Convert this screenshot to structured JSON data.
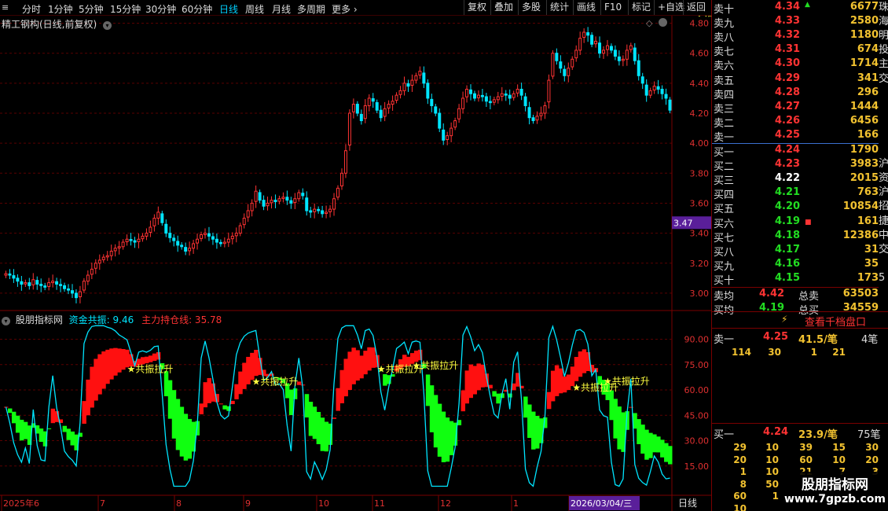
{
  "toolbar": {
    "periods": [
      "分时",
      "1分钟",
      "5分钟",
      "15分钟",
      "30分钟",
      "60分钟",
      "日线",
      "周线",
      "月线",
      "多周期",
      "更多"
    ],
    "active_period": "日线",
    "tools": [
      "复权",
      "叠加",
      "多股",
      "统计",
      "画线",
      "F10",
      "标记",
      "+自选",
      "返回"
    ]
  },
  "main_chart": {
    "title": "精工钢构(日线,前复权)",
    "price_ticks": [
      "4.80",
      "4.60",
      "4.40",
      "4.20",
      "4.00",
      "3.80",
      "3.60",
      "3.40",
      "3.20",
      "3.00"
    ],
    "current_price_tag": "3.47"
  },
  "indicator": {
    "name": "股朋指标网",
    "line1_label": "资金共振: 9.46",
    "line2_label": "主力持仓线: 35.78",
    "ticks": [
      "90.00",
      "75.00",
      "60.00",
      "45.00",
      "30.00",
      "15.00"
    ],
    "signal_label": "★共振拉升"
  },
  "x_axis": {
    "labels": [
      "2025年6",
      "7",
      "8",
      "9",
      "10",
      "11",
      "12",
      "1",
      "2026/03/04/三"
    ],
    "period_label": "日线"
  },
  "chart_data": {
    "type": "candlestick",
    "symbol": "精工钢构",
    "period": "日线",
    "ylim": [
      2.9,
      4.85
    ],
    "closes": [
      3.13,
      3.12,
      3.1,
      3.08,
      3.06,
      3.07,
      3.05,
      3.09,
      3.06,
      3.05,
      3.04,
      3.07,
      3.08,
      3.06,
      3.05,
      3.03,
      3.02,
      3.0,
      2.97,
      3.01,
      3.08,
      3.12,
      3.16,
      3.2,
      3.22,
      3.24,
      3.25,
      3.28,
      3.3,
      3.31,
      3.34,
      3.36,
      3.35,
      3.34,
      3.36,
      3.38,
      3.4,
      3.44,
      3.5,
      3.54,
      3.47,
      3.4,
      3.37,
      3.35,
      3.32,
      3.31,
      3.28,
      3.3,
      3.33,
      3.36,
      3.39,
      3.4,
      3.38,
      3.36,
      3.34,
      3.33,
      3.34,
      3.36,
      3.38,
      3.4,
      3.45,
      3.5,
      3.55,
      3.6,
      3.68,
      3.62,
      3.58,
      3.6,
      3.62,
      3.61,
      3.63,
      3.64,
      3.62,
      3.6,
      3.63,
      3.67,
      3.65,
      3.55,
      3.54,
      3.56,
      3.55,
      3.53,
      3.54,
      3.56,
      3.63,
      3.7,
      3.8,
      3.95,
      4.2,
      4.26,
      4.2,
      4.15,
      4.25,
      4.3,
      4.28,
      4.22,
      4.17,
      4.23,
      4.26,
      4.28,
      4.32,
      4.35,
      4.4,
      4.38,
      4.42,
      4.45,
      4.48,
      4.4,
      4.3,
      4.25,
      4.2,
      4.1,
      4.02,
      4.05,
      4.1,
      4.15,
      4.23,
      4.3,
      4.36,
      4.33,
      4.3,
      4.32,
      4.31,
      4.28,
      4.27,
      4.29,
      4.31,
      4.33,
      4.32,
      4.3,
      4.33,
      4.36,
      4.32,
      4.25,
      4.17,
      4.15,
      4.18,
      4.2,
      4.25,
      4.42,
      4.6,
      4.55,
      4.5,
      4.45,
      4.5,
      4.56,
      4.62,
      4.7,
      4.74,
      4.72,
      4.66,
      4.68,
      4.6,
      4.62,
      4.65,
      4.62,
      4.58,
      4.55,
      4.56,
      4.62,
      4.65,
      4.55,
      4.45,
      4.4,
      4.32,
      4.35,
      4.38,
      4.36,
      4.33,
      4.3,
      4.22
    ],
    "resonance_label": "资金共振",
    "holding_label": "主力持仓线",
    "resonance_value": 9.46,
    "holding_value": 35.78,
    "indicator_ylim": [
      0,
      100
    ],
    "signal_days": [
      31,
      63,
      95,
      104,
      145,
      153,
      175,
      188
    ]
  },
  "orderbook": {
    "asks": [
      {
        "label": "卖十",
        "price": "4.34",
        "vol": "6677",
        "color": "#ff3333"
      },
      {
        "label": "卖九",
        "price": "4.33",
        "vol": "2580",
        "color": "#ff3333"
      },
      {
        "label": "卖八",
        "price": "4.32",
        "vol": "1180",
        "color": "#ff3333"
      },
      {
        "label": "卖七",
        "price": "4.31",
        "vol": "674",
        "color": "#ff3333"
      },
      {
        "label": "卖六",
        "price": "4.30",
        "vol": "1714",
        "color": "#ff3333"
      },
      {
        "label": "卖五",
        "price": "4.29",
        "vol": "341",
        "color": "#ff3333"
      },
      {
        "label": "卖四",
        "price": "4.28",
        "vol": "296",
        "color": "#ff3333"
      },
      {
        "label": "卖三",
        "price": "4.27",
        "vol": "1444",
        "color": "#ff3333"
      },
      {
        "label": "卖二",
        "price": "4.26",
        "vol": "6456",
        "color": "#ff3333"
      },
      {
        "label": "卖一",
        "price": "4.25",
        "vol": "166",
        "color": "#ff3333"
      }
    ],
    "bids": [
      {
        "label": "买一",
        "price": "4.24",
        "vol": "1790",
        "color": "#ff3333"
      },
      {
        "label": "买二",
        "price": "4.23",
        "vol": "3983",
        "color": "#ff3333"
      },
      {
        "label": "买三",
        "price": "4.22",
        "vol": "2015",
        "color": "#ffffff"
      },
      {
        "label": "买四",
        "price": "4.21",
        "vol": "763",
        "color": "#22dd22"
      },
      {
        "label": "买五",
        "price": "4.20",
        "vol": "10854",
        "color": "#22dd22"
      },
      {
        "label": "买六",
        "price": "4.19",
        "vol": "161",
        "color": "#22dd22"
      },
      {
        "label": "买七",
        "price": "4.18",
        "vol": "12386",
        "color": "#22dd22"
      },
      {
        "label": "买八",
        "price": "4.17",
        "vol": "31",
        "color": "#22dd22"
      },
      {
        "label": "买九",
        "price": "4.16",
        "vol": "35",
        "color": "#22dd22"
      },
      {
        "label": "买十",
        "price": "4.15",
        "vol": "173",
        "color": "#22dd22"
      }
    ],
    "avg_sell": {
      "label": "卖均",
      "price": "4.42",
      "total_label": "总卖",
      "total": "63503"
    },
    "avg_buy": {
      "label": "买均",
      "price": "4.19",
      "total_label": "总买",
      "total": "34559"
    },
    "side_strip_chars": [
      "珠",
      "海",
      "明",
      "投",
      "主",
      "交",
      "",
      "",
      "",
      "",
      "",
      "沪",
      "资",
      "沪",
      "招",
      "捷",
      "中",
      "交",
      "",
      "5",
      "",
      ""
    ],
    "depth_button": "查看千档盘口",
    "queue_sell": {
      "label": "卖一",
      "price": "4.25",
      "avg": "41.5/笔",
      "count": "4笔",
      "cells": [
        "114",
        "30",
        "1",
        "21"
      ]
    },
    "queue_buy": {
      "label": "买一",
      "price": "4.24",
      "avg": "23.9/笔",
      "count": "75笔",
      "rows": [
        [
          "29",
          "10",
          "39",
          "15",
          "30"
        ],
        [
          "20",
          "10",
          "60",
          "10",
          "20"
        ],
        [
          "1",
          "10",
          "21",
          "7",
          "3"
        ],
        [
          "8",
          "50",
          "",
          "",
          ""
        ],
        [
          "60",
          "1",
          "",
          "",
          ""
        ],
        [
          "10",
          "",
          "",
          "",
          ""
        ]
      ]
    }
  },
  "watermark": {
    "line1": "股朋指标网",
    "line2": "www.7gpzb.com"
  },
  "colors": {
    "up": "#ff3333",
    "down": "#00e5ff",
    "green": "#22dd22",
    "yellow": "#f2c230",
    "grid": "#5a0000",
    "purple": "#5a1f9a"
  }
}
